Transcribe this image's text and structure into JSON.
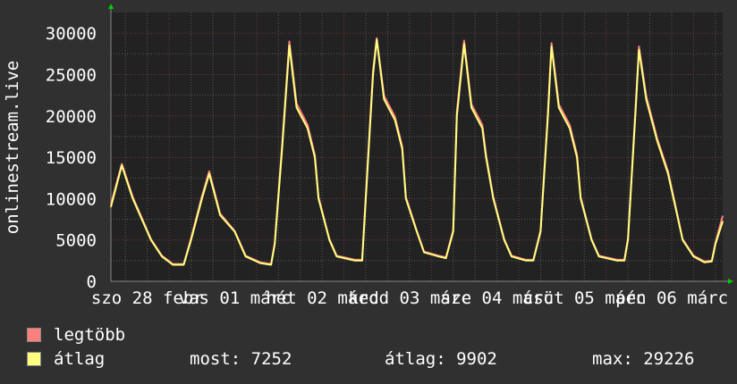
{
  "chart_data": {
    "type": "line",
    "ylabel": "onlinestream.live",
    "xlabel": "",
    "ylim": [
      0,
      32500
    ],
    "yticks": [
      0,
      5000,
      10000,
      15000,
      20000,
      25000,
      30000
    ],
    "xlim": [
      "02-28 00:00",
      "03-07 00:00"
    ],
    "xtick_labels": [
      "szo 28 febr",
      "vas 01 márc",
      "hét 02 márc",
      "kedd 03 márc",
      "sze 04 márc",
      "csüt 05 márc",
      "pén 06 márc"
    ],
    "grid": true,
    "background": "#222222",
    "x": [
      "02-28 00:00",
      "02-28 03:00",
      "02-28 06:00",
      "02-28 11:00",
      "02-28 14:00",
      "02-28 17:00",
      "02-28 20:00",
      "02-28 22:00",
      "03-01 01:00",
      "03-01 03:00",
      "03-01 06:00",
      "03-01 10:00",
      "03-01 13:00",
      "03-01 17:00",
      "03-01 20:00",
      "03-01 21:00",
      "03-01 23:00",
      "03-02 01:00",
      "03-02 03:00",
      "03-02 06:00",
      "03-02 08:00",
      "03-02 09:00",
      "03-02 12:00",
      "03-02 14:00",
      "03-02 19:00",
      "03-02 21:00",
      "03-02 22:00",
      "03-03 00:00",
      "03-03 01:00",
      "03-03 03:00",
      "03-03 06:00",
      "03-03 08:00",
      "03-03 09:00",
      "03-03 12:00",
      "03-03 14:00",
      "03-03 18:00",
      "03-03 20:00",
      "03-03 22:00",
      "03-03 23:00",
      "03-04 01:00",
      "03-04 03:00",
      "03-04 06:00",
      "03-04 07:00",
      "03-04 09:00",
      "03-04 12:00",
      "03-04 14:00",
      "03-04 18:00",
      "03-04 20:00",
      "03-04 22:00",
      "03-05 00:00",
      "03-05 01:00",
      "03-05 03:00",
      "03-05 06:00",
      "03-05 08:00",
      "03-05 09:00",
      "03-05 12:00",
      "03-05 14:00",
      "03-05 19:00",
      "03-05 21:00",
      "03-05 22:00",
      "03-06 00:00",
      "03-06 01:00",
      "03-06 03:00",
      "03-06 06:00",
      "03-06 09:00",
      "03-06 11:00",
      "03-06 13:00",
      "03-06 16:00",
      "03-06 19:00",
      "03-06 21:00",
      "03-06 22:00",
      "03-07 00:00"
    ],
    "series": [
      {
        "name": "legtöbb",
        "color": "#FF7F7F",
        "values": [
          9300,
          14200,
          10200,
          5100,
          3100,
          2100,
          2100,
          5200,
          10300,
          13300,
          8200,
          6100,
          3100,
          2300,
          2100,
          4700,
          16500,
          29000,
          21500,
          18900,
          15300,
          10200,
          5100,
          3100,
          2600,
          2600,
          10500,
          25500,
          29400,
          22400,
          19900,
          16300,
          10200,
          6100,
          3600,
          3100,
          2900,
          6200,
          20500,
          29100,
          21400,
          18900,
          15300,
          10200,
          5100,
          3100,
          2600,
          2600,
          6200,
          20500,
          28800,
          21400,
          18900,
          15300,
          10200,
          5100,
          3100,
          2600,
          2600,
          5200,
          20500,
          28400,
          22400,
          17300,
          13300,
          9200,
          5100,
          3100,
          2400,
          2500,
          4700,
          7900
        ]
      },
      {
        "name": "átlag",
        "color": "#FFFF7F",
        "values": [
          9000,
          14000,
          10000,
          5000,
          3000,
          2000,
          2000,
          5000,
          10000,
          13000,
          8000,
          6000,
          3000,
          2200,
          2000,
          4500,
          16000,
          28500,
          21000,
          18500,
          15000,
          10000,
          5000,
          3000,
          2500,
          2500,
          10000,
          25000,
          29226,
          22000,
          19500,
          16000,
          10000,
          6000,
          3500,
          3000,
          2800,
          6000,
          20000,
          28700,
          21000,
          18500,
          15000,
          10000,
          5000,
          3000,
          2500,
          2500,
          6000,
          20000,
          28400,
          21000,
          18500,
          15000,
          10000,
          5000,
          3000,
          2500,
          2500,
          5000,
          20000,
          28000,
          22000,
          17000,
          13000,
          9000,
          5000,
          3000,
          2300,
          2400,
          4500,
          7252
        ]
      }
    ]
  },
  "legend": {
    "items": [
      {
        "label": "legtöbb",
        "color": "#FF7F7F"
      },
      {
        "label": "átlag",
        "color": "#FFFF7F"
      }
    ],
    "stats": {
      "now": "most: 7252",
      "avg": "átlag: 9902",
      "max": "max: 29226"
    }
  }
}
